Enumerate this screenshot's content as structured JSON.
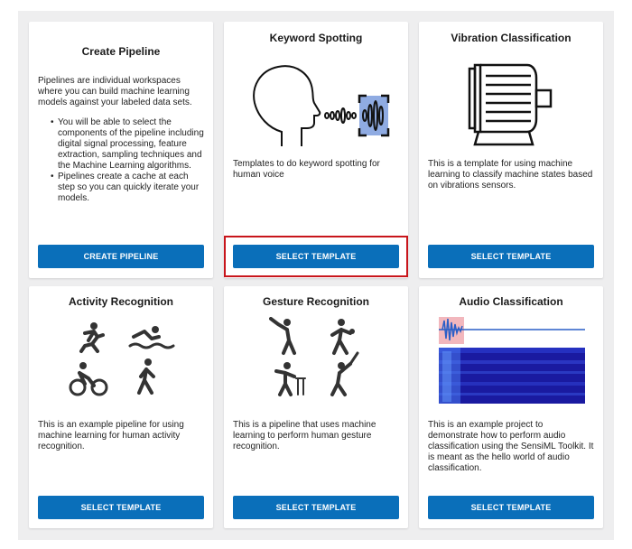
{
  "cards": [
    {
      "title": "Create Pipeline",
      "description": "Pipelines are individual workspaces where you can build machine learning models against your labeled data sets.",
      "bullets": [
        "You will be able to select the components of the pipeline including digital signal processing, feature extraction, sampling techniques and the Machine Learning algorithms.",
        "Pipelines create a cache at each step so you can quickly iterate your models."
      ],
      "button": "CREATE PIPELINE"
    },
    {
      "title": "Keyword Spotting",
      "description": "Templates to do keyword spotting for human voice",
      "button": "SELECT TEMPLATE",
      "icon": "head-voice-icon"
    },
    {
      "title": "Vibration Classification",
      "description": "This is a template for using machine learning to classify machine states based on vibrations sensors.",
      "button": "SELECT TEMPLATE",
      "icon": "motor-icon"
    },
    {
      "title": "Activity Recognition",
      "description": "This is an example pipeline for using machine learning for human activity recognition.",
      "button": "SELECT TEMPLATE",
      "icon": "activity-icons"
    },
    {
      "title": "Gesture Recognition",
      "description": "This is a pipeline that uses machine learning to perform human gesture recognition.",
      "button": "SELECT TEMPLATE",
      "icon": "gesture-icons"
    },
    {
      "title": "Audio Classification",
      "description": "This is an example project to demonstrate how to perform audio classification using the SensiML Toolkit. It is meant as the hello world of audio classification.",
      "button": "SELECT TEMPLATE",
      "icon": "spectrogram-image"
    }
  ],
  "colors": {
    "button": "#0a6fba",
    "highlight": "#c8151b",
    "background": "#eeeeef"
  }
}
